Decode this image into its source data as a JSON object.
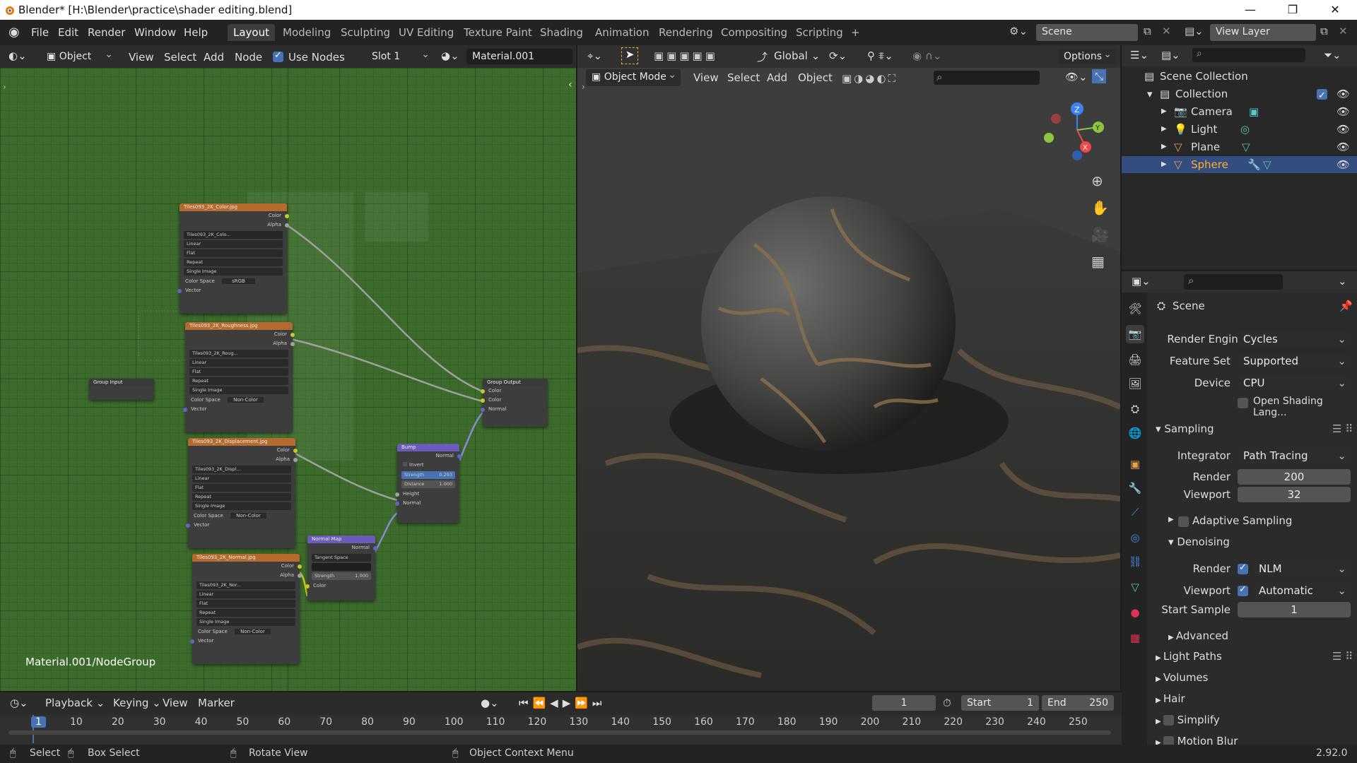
{
  "titlebar": {
    "title": "Blender* [H:\\Blender\\practice\\shader editing.blend]",
    "min": "—",
    "max": "❐",
    "close": "✕"
  },
  "menu": [
    "File",
    "Edit",
    "Render",
    "Window",
    "Help"
  ],
  "workspaces": [
    "Layout",
    "Modeling",
    "Sculpting",
    "UV Editing",
    "Texture Paint",
    "Shading",
    "Animation",
    "Rendering",
    "Compositing",
    "Scripting",
    "+"
  ],
  "scene": {
    "label": "Scene",
    "view_layer": "View Layer"
  },
  "node_header": {
    "mode": "Object",
    "view": "View",
    "select": "Select",
    "add": "Add",
    "node": "Node",
    "use_nodes": "Use Nodes",
    "slot": "Slot 1",
    "material": "Material.001"
  },
  "vp_header": {
    "transform": "Global",
    "options": "Options",
    "mode": "Object Mode",
    "view": "View",
    "select": "Select",
    "add": "Add",
    "object": "Object"
  },
  "node_editor": {
    "breadcrumb": "Material.001/NodeGroup",
    "img_nodes": [
      {
        "title": "Tiles093_2K_Color.jpg",
        "file": "Tiles093_2K_Colo...",
        "cs": "sRGB"
      },
      {
        "title": "Tiles093_2K_Roughness.jpg",
        "file": "Tiles093_2K_Roug...",
        "cs": "Non-Color"
      },
      {
        "title": "Tiles093_2K_Displacement.jpg",
        "file": "Tiles093_2K_Displ...",
        "cs": "Non-Color"
      },
      {
        "title": "Tiles093_2K_Normal.jpg",
        "file": "Tiles093_2K_Nor...",
        "cs": "Non-Color"
      }
    ],
    "img_opts": {
      "out_color": "Color",
      "out_alpha": "Alpha",
      "interp": "Linear",
      "proj": "Flat",
      "ext": "Repeat",
      "src": "Single Image",
      "cs_label": "Color Space",
      "vector": "Vector"
    },
    "group_input": "Group Input",
    "group_output": {
      "title": "Group Output",
      "s1": "Color",
      "s2": "Color",
      "s3": "Normal"
    },
    "bump": {
      "title": "Bump",
      "out": "Normal",
      "invert": "Invert",
      "strength": "Strength",
      "strength_v": "0.293",
      "distance": "Distance",
      "distance_v": "1.000",
      "height": "Height",
      "normal": "Normal"
    },
    "normal_map": {
      "title": "Normal Map",
      "out": "Normal",
      "space": "Tangent Space",
      "strength": "Strength",
      "strength_v": "1.000",
      "color": "Color"
    }
  },
  "outliner": {
    "scene_collection": "Scene Collection",
    "collection": "Collection",
    "items": [
      "Camera",
      "Light",
      "Plane",
      "Sphere"
    ]
  },
  "properties": {
    "scene": "Scene",
    "render_engine": {
      "label": "Render Engine",
      "value": "Cycles"
    },
    "feature_set": {
      "label": "Feature Set",
      "value": "Supported"
    },
    "device": {
      "label": "Device",
      "value": "CPU"
    },
    "osl": "Open Shading Lang...",
    "sampling": "Sampling",
    "integrator": {
      "label": "Integrator",
      "value": "Path Tracing"
    },
    "render": {
      "label": "Render",
      "value": "200"
    },
    "viewport": {
      "label": "Viewport",
      "value": "32"
    },
    "adaptive": "Adaptive Sampling",
    "denoising": "Denoising",
    "dn_render": {
      "label": "Render",
      "value": "NLM"
    },
    "dn_viewport": {
      "label": "Viewport",
      "value": "Automatic"
    },
    "start_sample": {
      "label": "Start Sample",
      "value": "1"
    },
    "advanced": "Advanced",
    "light_paths": "Light Paths",
    "volumes": "Volumes",
    "hair": "Hair",
    "simplify": "Simplify",
    "motion_blur": "Motion Blur"
  },
  "timeline": {
    "playback": "Playback",
    "keying": "Keying",
    "view": "View",
    "marker": "Marker",
    "frame": "1",
    "start_label": "Start",
    "start": "1",
    "end_label": "End",
    "end": "250",
    "ticks": [
      "1",
      "10",
      "20",
      "30",
      "40",
      "50",
      "60",
      "70",
      "80",
      "90",
      "100",
      "110",
      "120",
      "130",
      "140",
      "150",
      "160",
      "170",
      "180",
      "190",
      "200",
      "210",
      "220",
      "230",
      "240",
      "250"
    ]
  },
  "status": {
    "select": "Select",
    "box_select": "Box Select",
    "rotate": "Rotate View",
    "context": "Object Context Menu",
    "version": "2.92.0"
  }
}
